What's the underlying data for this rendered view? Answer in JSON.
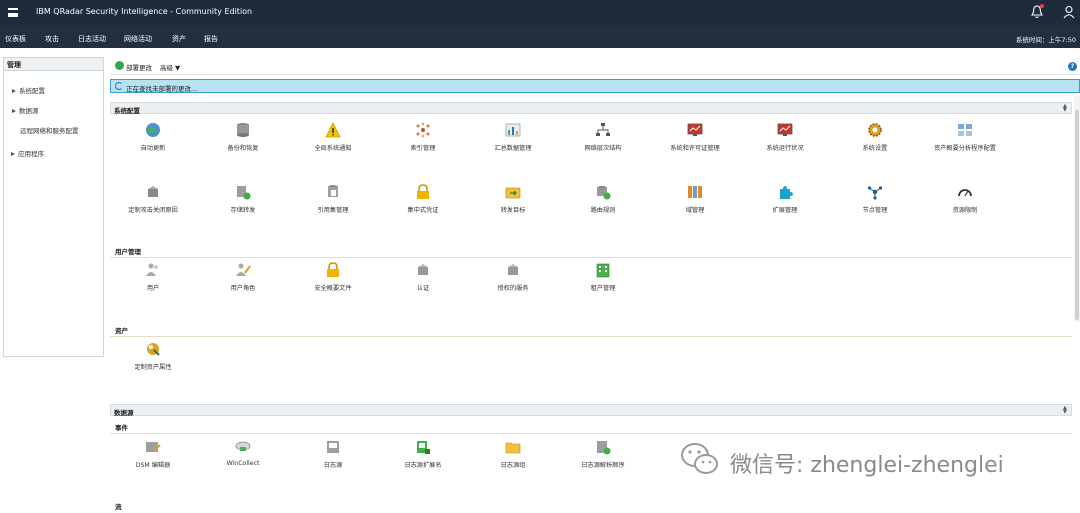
{
  "app": {
    "title": "IBM QRadar Security Intelligence - Community Edition"
  },
  "nav": {
    "items": [
      "仪表板",
      "攻击",
      "日志活动",
      "网络活动",
      "资产",
      "报告"
    ],
    "system_time": "系统时间：上午7:50"
  },
  "sidebar": {
    "header": "管理",
    "items": [
      "系统配置",
      "数据源",
      "远程网络和服务配置",
      "应用程序"
    ]
  },
  "toolbar": {
    "deploy_label": "部署更改",
    "advanced_label": "高级 ▼",
    "help_symbol": "?"
  },
  "notice": {
    "text": "正在查找未部署的更改..."
  },
  "sections": {
    "system_config": "系统配置",
    "data_sources": "数据源"
  },
  "groups": {
    "user_management": "用户管理",
    "assets": "资产",
    "events": "事件",
    "flows": "流"
  },
  "system_tiles_row1": [
    "自动更新",
    "备份和恢复",
    "全局系统通知",
    "索引管理",
    "汇总数据管理",
    "网络层次结构",
    "系统和许可证管理",
    "系统运行状况",
    "系统设置",
    "资产概要分析程序配置"
  ],
  "system_tiles_row2": [
    "定制攻击关闭原因",
    "存储转发",
    "引用集管理",
    "集中式凭证",
    "转发目标",
    "路由规则",
    "域管理",
    "扩展管理",
    "节点管理",
    "资源限制"
  ],
  "user_tiles": [
    "用户",
    "用户角色",
    "安全概要文件",
    "认证",
    "授权的服务",
    "租户管理"
  ],
  "asset_tiles": [
    "定制资产属性"
  ],
  "event_tiles": [
    "DSM 编辑器",
    "WinCollect",
    "日志源",
    "日志源扩展名",
    "日志源组",
    "日志源解析顺序"
  ],
  "watermark": {
    "text": "微信号: zhenglei-zhenglei"
  },
  "colors": {
    "topbar": "#1d2b3a",
    "navbar": "#232f3e",
    "notice_bg": "#b8e2f2",
    "accent": "#2a74b8"
  }
}
